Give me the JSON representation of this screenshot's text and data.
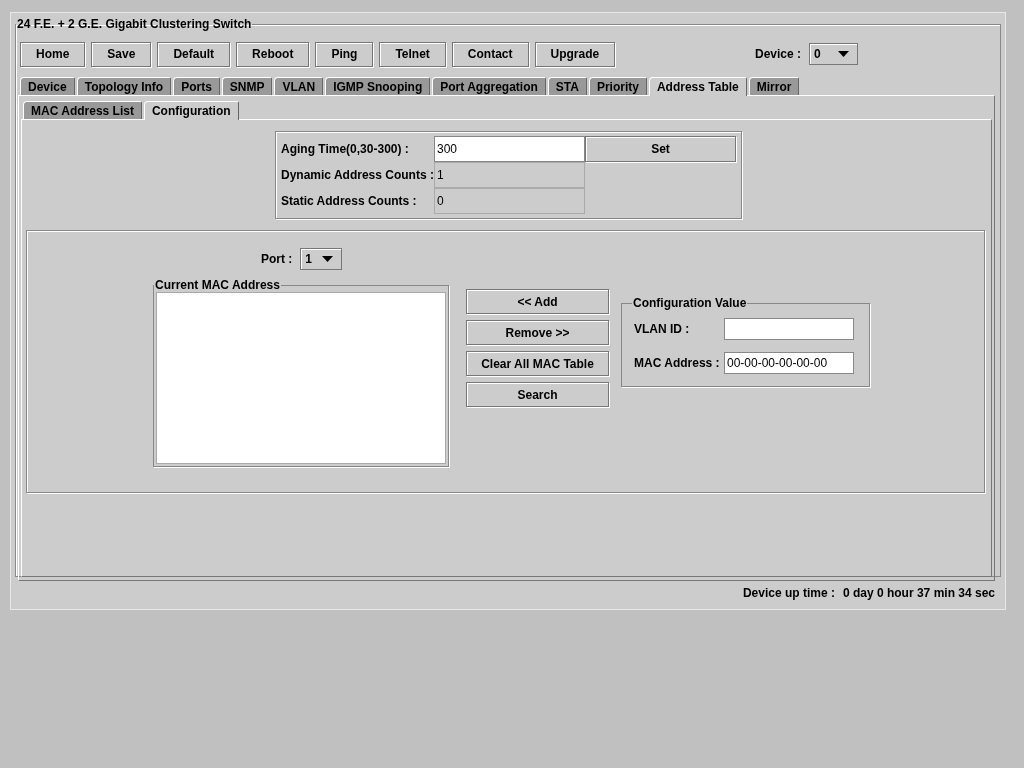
{
  "window": {
    "title": "24 F.E. + 2 G.E. Gigabit Clustering Switch"
  },
  "toolbar": {
    "buttons": [
      "Home",
      "Save",
      "Default",
      "Reboot",
      "Ping",
      "Telnet",
      "Contact",
      "Upgrade"
    ],
    "device": {
      "label": "Device :",
      "value": "0"
    }
  },
  "tabs": [
    {
      "label": "Device",
      "selected": false
    },
    {
      "label": "Topology Info",
      "selected": false
    },
    {
      "label": "Ports",
      "selected": false
    },
    {
      "label": "SNMP",
      "selected": false
    },
    {
      "label": "VLAN",
      "selected": false
    },
    {
      "label": "IGMP Snooping",
      "selected": false
    },
    {
      "label": "Port Aggregation",
      "selected": false
    },
    {
      "label": "STA",
      "selected": false
    },
    {
      "label": "Priority",
      "selected": false
    },
    {
      "label": "Address Table",
      "selected": true
    },
    {
      "label": "Mirror",
      "selected": false
    }
  ],
  "subtabs": [
    {
      "label": "MAC Address List",
      "selected": false
    },
    {
      "label": "Configuration",
      "selected": true
    }
  ],
  "aging": {
    "label": "Aging Time(0,30-300) :",
    "value": "300",
    "button": "Set"
  },
  "counts": [
    {
      "label": "Dynamic Address Counts :",
      "value": "1"
    },
    {
      "label": "Static Address Counts :",
      "value": "0"
    }
  ],
  "port": {
    "label": "Port :",
    "value": "1"
  },
  "mac_list": {
    "title": "Current MAC Address"
  },
  "actions": [
    "<< Add",
    "Remove >>",
    "Clear All MAC Table",
    "Search"
  ],
  "config": {
    "title": "Configuration Value",
    "fields": [
      {
        "label": "VLAN ID :"
      },
      {
        "label": "MAC Address :",
        "value": "00-00-00-00-00-00"
      }
    ]
  },
  "status_bar": {
    "label": "Device up time :",
    "value": "0 day 0 hour 37 min 34 sec"
  }
}
